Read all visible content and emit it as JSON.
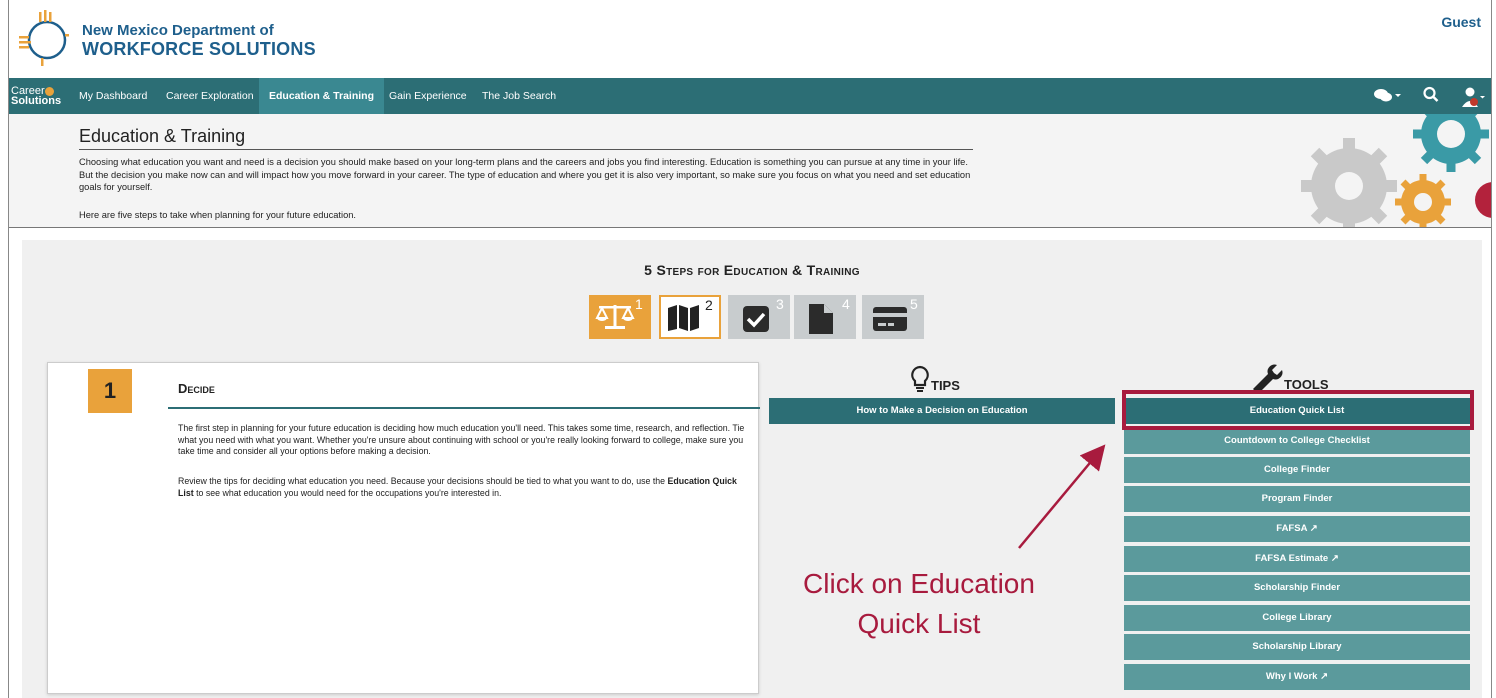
{
  "header": {
    "org_line1": "New Mexico Department of",
    "org_line2": "WORKFORCE SOLUTIONS",
    "guest": "Guest"
  },
  "nav": {
    "brand_line1": "Career",
    "brand_line2": "Solutions",
    "items": [
      "My Dashboard",
      "Career Exploration",
      "Education & Training",
      "Gain Experience",
      "The Job Search"
    ],
    "active_index": 2,
    "icons": [
      "chat-icon",
      "search-icon",
      "user-icon"
    ]
  },
  "intro": {
    "title": "Education & Training",
    "para1": "Choosing what education you want and need is a decision you should make based on your long-term plans and the careers and jobs you find interesting. Education is something you can pursue at any time in your life. But the decision you make now can and will impact how you move forward in your career. The type of education and where you get it is also very important, so make sure you focus on what you need and set education goals for yourself.",
    "para2": "Here are five steps to take when planning for your future education."
  },
  "steps": {
    "title": "5 Steps for Education & Training",
    "items": [
      {
        "num": "1",
        "icon": "balance-scale-icon"
      },
      {
        "num": "2",
        "icon": "map-icon"
      },
      {
        "num": "3",
        "icon": "checkbox-icon"
      },
      {
        "num": "4",
        "icon": "document-icon"
      },
      {
        "num": "5",
        "icon": "credit-card-icon"
      }
    ]
  },
  "decide": {
    "number": "1",
    "title": "Decide",
    "para1": "The first step in planning for your future education is deciding how much education you'll need. This takes some time, research, and reflection. Tie what you need with what you want. Whether you're unsure about continuing with school or you're really looking forward to college, make sure you take time and consider all your options before making a decision.",
    "para2_pre": "Review the tips for deciding what education you need. Because your decisions should be tied to what you want to do, use the ",
    "para2_bold": "Education Quick List",
    "para2_post": " to see what education you would need for the occupations you're interested in."
  },
  "tips": {
    "heading": "TIPS",
    "button": "How to Make a Decision on Education"
  },
  "tools": {
    "heading": "TOOLS",
    "items": [
      {
        "label": "Education Quick List",
        "external": false
      },
      {
        "label": "Countdown to College Checklist",
        "external": false
      },
      {
        "label": "College Finder",
        "external": false
      },
      {
        "label": "Program Finder",
        "external": false
      },
      {
        "label": "FAFSA",
        "external": true
      },
      {
        "label": "FAFSA Estimate",
        "external": true
      },
      {
        "label": "Scholarship Finder",
        "external": false
      },
      {
        "label": "College Library",
        "external": false
      },
      {
        "label": "Scholarship Library",
        "external": false
      },
      {
        "label": "Why I Work",
        "external": true
      }
    ]
  },
  "annotation": {
    "line1": "Click on Education",
    "line2": "Quick List"
  },
  "colors": {
    "teal": "#2c6e75",
    "teal_light": "#5b9a9c",
    "orange": "#e9a23b",
    "highlight": "#a81b3e",
    "brand_blue": "#1e5f8c"
  }
}
